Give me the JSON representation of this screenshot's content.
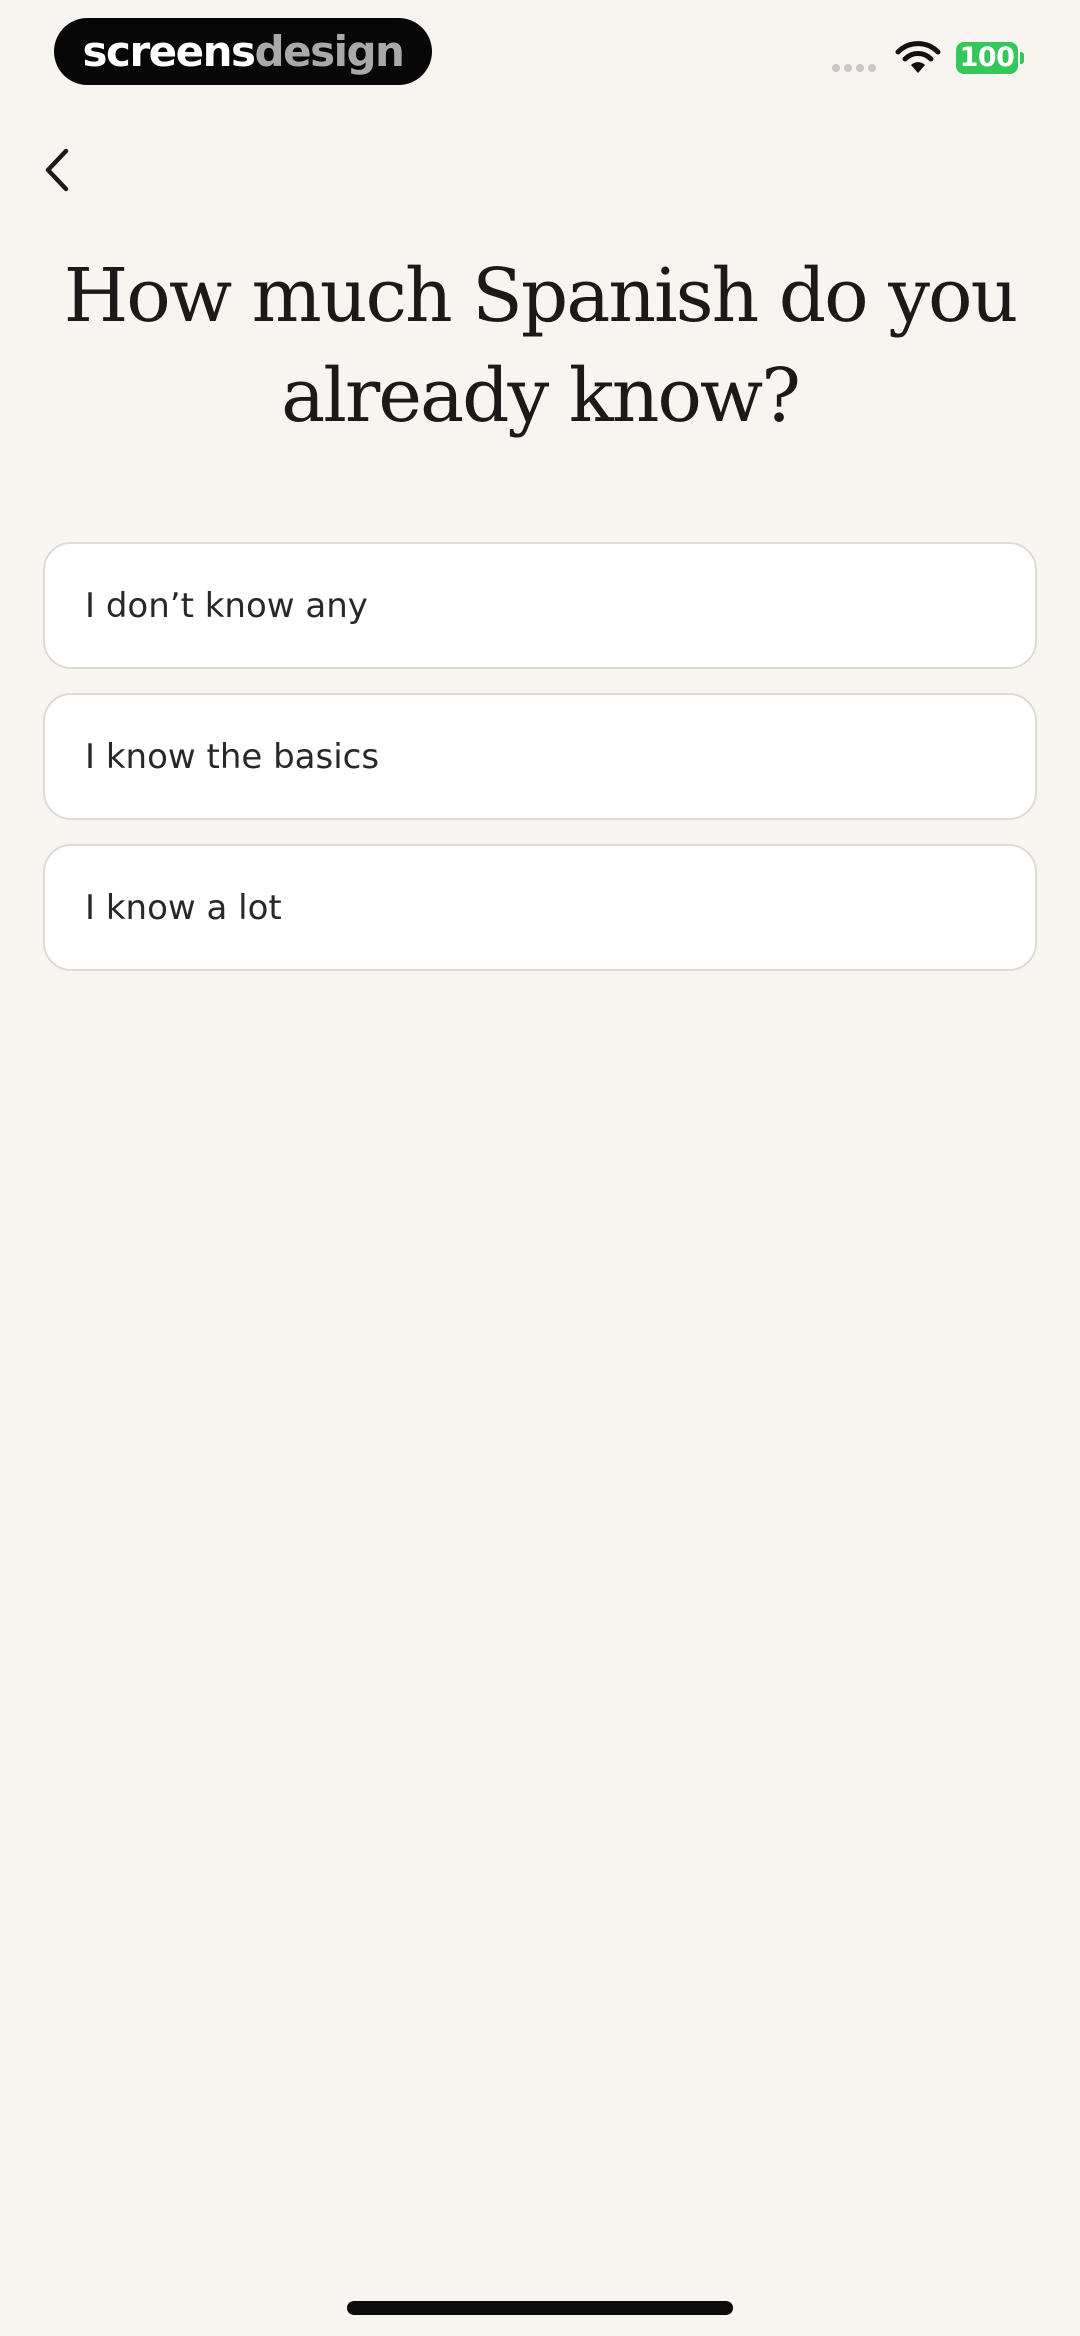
{
  "status_bar": {
    "brand_part1": "screens",
    "brand_part2": "design",
    "battery": "100",
    "icons": [
      "signal-dots-icon",
      "wifi-icon",
      "battery-icon"
    ]
  },
  "nav": {
    "back_icon": "chevron-left-icon"
  },
  "question": {
    "title": "How much Spanish do you already know?"
  },
  "options": [
    {
      "label": "I don’t know any"
    },
    {
      "label": "I know the basics"
    },
    {
      "label": "I know a lot"
    }
  ],
  "colors": {
    "background": "#f8f4f0",
    "option_background": "#ffffff",
    "option_border": "#dedad6",
    "text": "#1c1a19",
    "battery": "#34c759"
  }
}
